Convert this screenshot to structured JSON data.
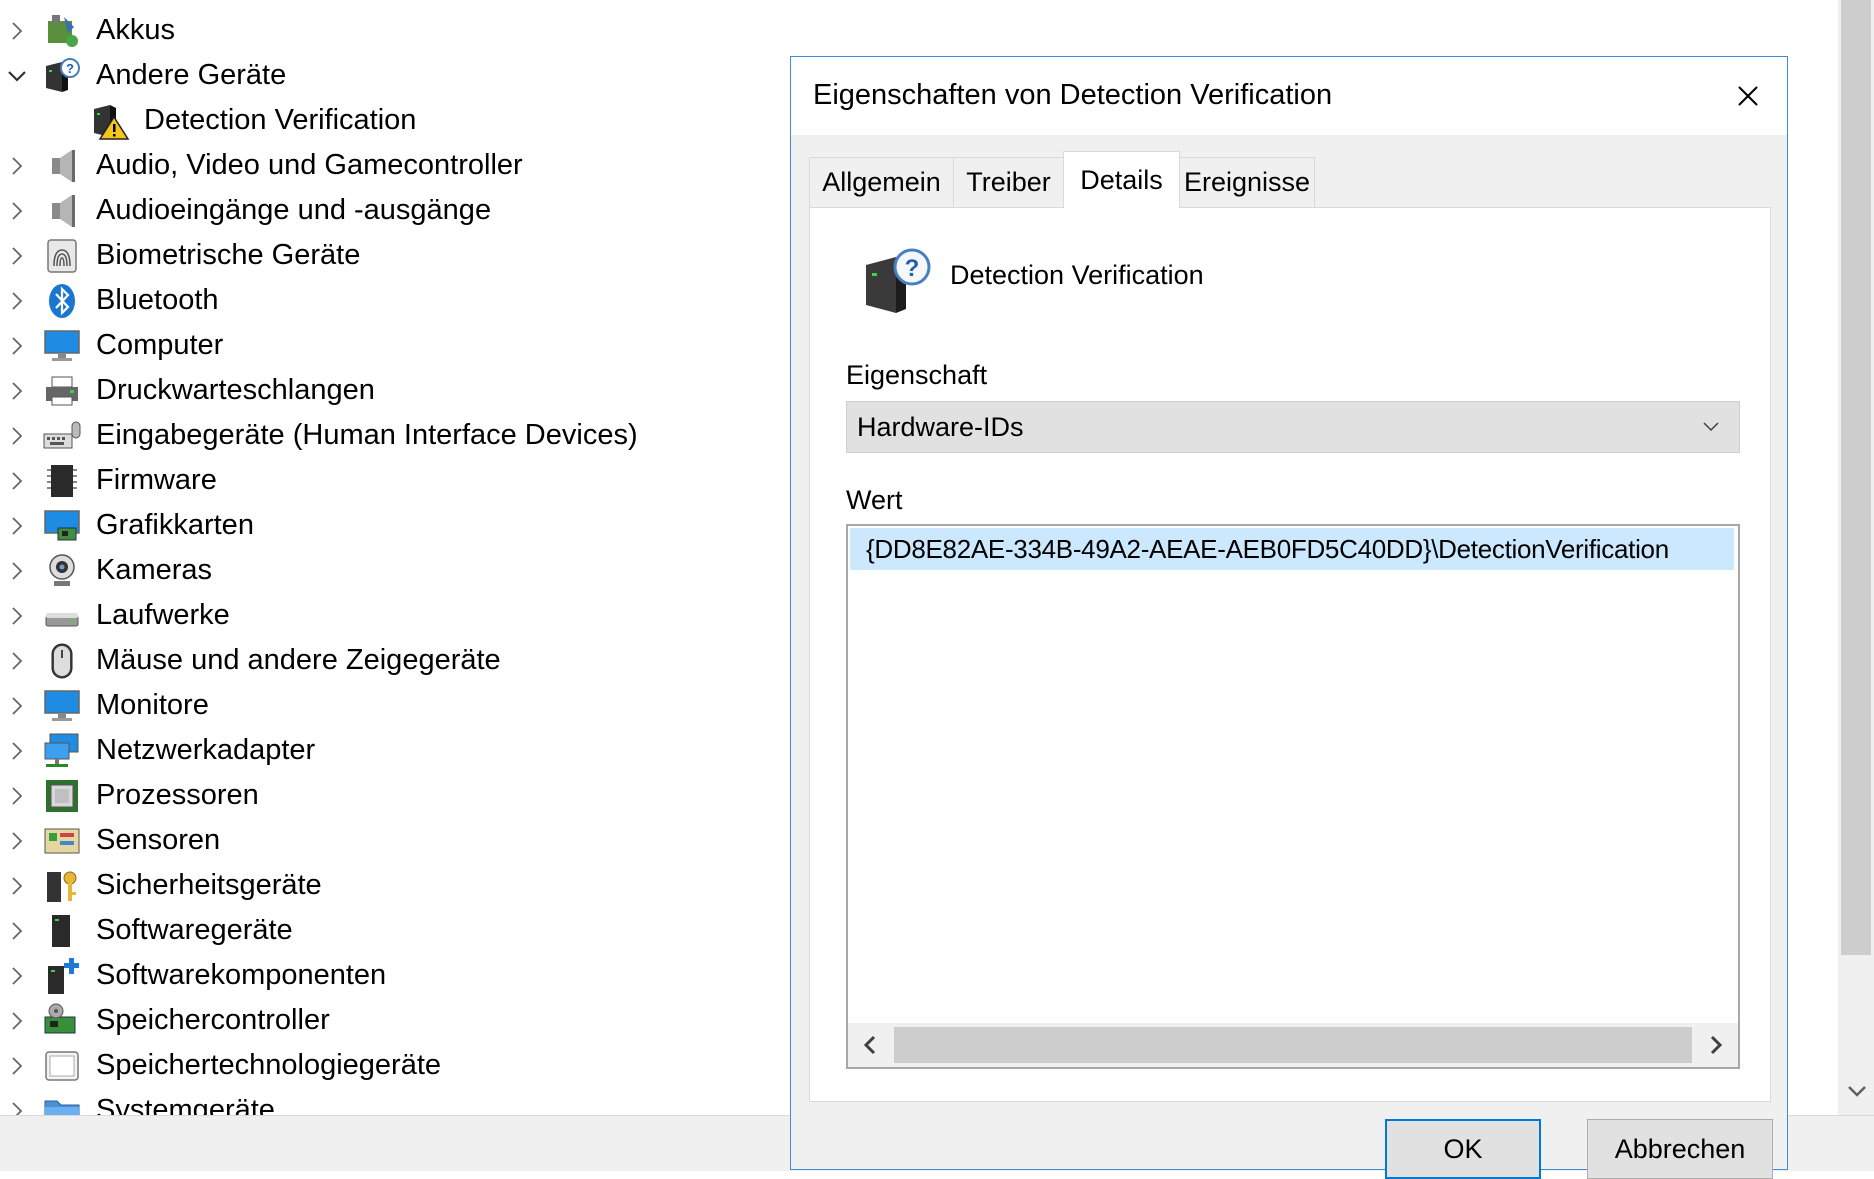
{
  "tree": {
    "items": [
      {
        "label": "Akkus",
        "icon": "battery-icon",
        "expanded": false
      },
      {
        "label": "Andere Geräte",
        "icon": "unknown-device-icon",
        "expanded": true
      },
      {
        "label": "Detection Verification",
        "icon": "warning-device-icon",
        "child": true
      },
      {
        "label": "Audio, Video und Gamecontroller",
        "icon": "speaker-icon",
        "expanded": false
      },
      {
        "label": "Audioeingänge und -ausgänge",
        "icon": "speaker-icon",
        "expanded": false
      },
      {
        "label": "Biometrische Geräte",
        "icon": "fingerprint-icon",
        "expanded": false
      },
      {
        "label": "Bluetooth",
        "icon": "bluetooth-icon",
        "expanded": false
      },
      {
        "label": "Computer",
        "icon": "monitor-icon",
        "expanded": false
      },
      {
        "label": "Druckwarteschlangen",
        "icon": "printer-icon",
        "expanded": false
      },
      {
        "label": "Eingabegeräte (Human Interface Devices)",
        "icon": "keyboard-icon",
        "expanded": false
      },
      {
        "label": "Firmware",
        "icon": "chip-icon",
        "expanded": false
      },
      {
        "label": "Grafikkarten",
        "icon": "display-adapter-icon",
        "expanded": false
      },
      {
        "label": "Kameras",
        "icon": "webcam-icon",
        "expanded": false
      },
      {
        "label": "Laufwerke",
        "icon": "drive-icon",
        "expanded": false
      },
      {
        "label": "Mäuse und andere Zeigegeräte",
        "icon": "mouse-icon",
        "expanded": false
      },
      {
        "label": "Monitore",
        "icon": "monitor-icon",
        "expanded": false
      },
      {
        "label": "Netzwerkadapter",
        "icon": "network-icon",
        "expanded": false
      },
      {
        "label": "Prozessoren",
        "icon": "processor-icon",
        "expanded": false
      },
      {
        "label": "Sensoren",
        "icon": "sensor-icon",
        "expanded": false
      },
      {
        "label": "Sicherheitsgeräte",
        "icon": "security-key-icon",
        "expanded": false
      },
      {
        "label": "Softwaregeräte",
        "icon": "software-device-icon",
        "expanded": false
      },
      {
        "label": "Softwarekomponenten",
        "icon": "software-component-icon",
        "expanded": false
      },
      {
        "label": "Speichercontroller",
        "icon": "storage-controller-icon",
        "expanded": false
      },
      {
        "label": "Speichertechnologiegeräte",
        "icon": "storage-tech-icon",
        "expanded": false
      },
      {
        "label": "Systemgeräte",
        "icon": "system-folder-icon",
        "expanded": false
      }
    ]
  },
  "dialog": {
    "title": "Eigenschaften von Detection Verification",
    "tabs": [
      {
        "label": "Allgemein",
        "active": false
      },
      {
        "label": "Treiber",
        "active": false
      },
      {
        "label": "Details",
        "active": true
      },
      {
        "label": "Ereignisse",
        "active": false
      }
    ],
    "device_name": "Detection Verification",
    "property_label": "Eigenschaft",
    "property_value": "Hardware-IDs",
    "value_label": "Wert",
    "values": [
      "{DD8E82AE-334B-49A2-AEAE-AEB0FD5C40DD}\\DetectionVerification"
    ],
    "ok_label": "OK",
    "cancel_label": "Abbrechen"
  },
  "colors": {
    "selection": "#cce8ff",
    "accent": "#0078d7",
    "dialog_border": "#3d8ed8"
  }
}
